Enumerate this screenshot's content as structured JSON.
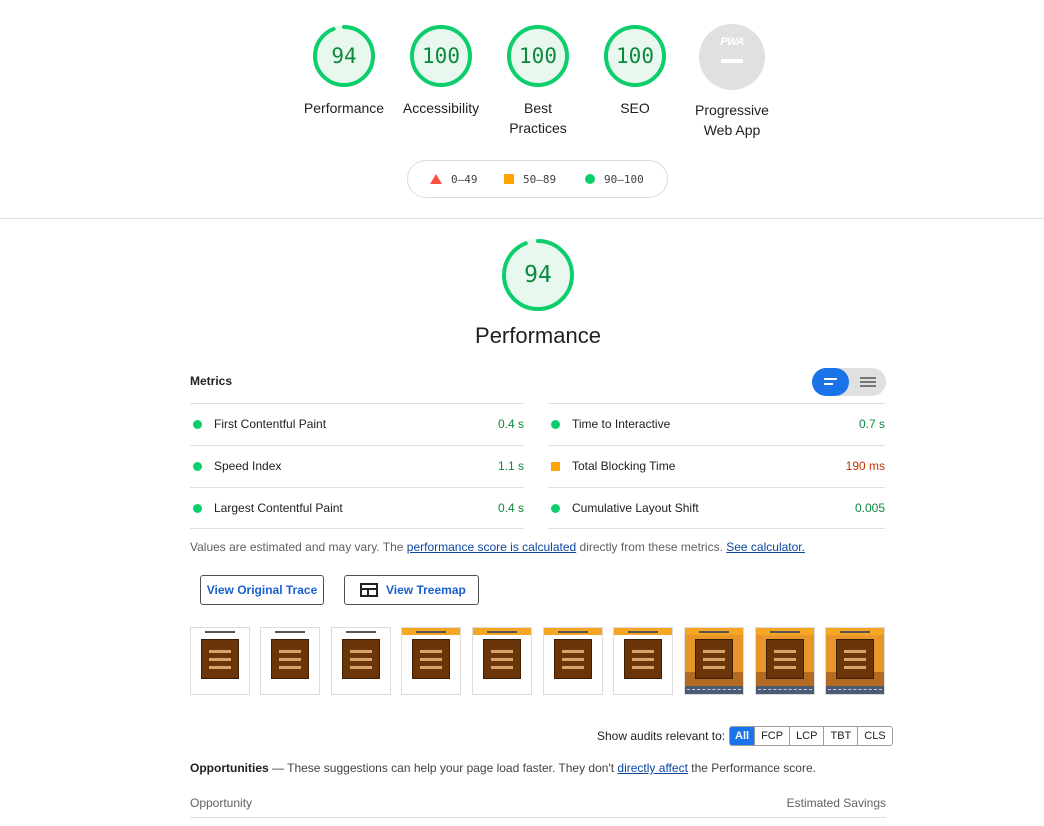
{
  "categories": [
    {
      "score": "94",
      "label": "Performance",
      "fraction": 0.94
    },
    {
      "score": "100",
      "label": "Accessibility",
      "fraction": 1.0
    },
    {
      "score": "100",
      "label": "Best Practices",
      "fraction": 1.0
    },
    {
      "score": "100",
      "label": "SEO",
      "fraction": 1.0
    }
  ],
  "pwa": {
    "badge_text": "PWA",
    "label": "Progressive Web App"
  },
  "legend": {
    "fail": "0–49",
    "average": "50–89",
    "pass": "90–100"
  },
  "performance": {
    "score": "94",
    "fraction": 0.94,
    "title": "Performance",
    "metrics_heading": "Metrics",
    "metrics_left": [
      {
        "name": "First Contentful Paint",
        "value": "0.4 s",
        "rating": "pass"
      },
      {
        "name": "Speed Index",
        "value": "1.1 s",
        "rating": "pass"
      },
      {
        "name": "Largest Contentful Paint",
        "value": "0.4 s",
        "rating": "pass"
      }
    ],
    "metrics_right": [
      {
        "name": "Time to Interactive",
        "value": "0.7 s",
        "rating": "pass"
      },
      {
        "name": "Total Blocking Time",
        "value": "190 ms",
        "rating": "average"
      },
      {
        "name": "Cumulative Layout Shift",
        "value": "0.005",
        "rating": "pass"
      }
    ],
    "note_prefix": "Values are estimated and may vary. The ",
    "note_link": "performance score is calculated",
    "note_middle": " directly from these metrics. ",
    "note_link2": "See calculator.",
    "view_trace": "View Original Trace",
    "view_treemap": "View Treemap"
  },
  "filmstrip": [
    {
      "header": "#ffffff",
      "bg": "#ffffff"
    },
    {
      "header": "#ffffff",
      "bg": "#ffffff"
    },
    {
      "header": "#ffffff",
      "bg": "#ffffff"
    },
    {
      "header": "#f5a623",
      "bg": "#ffffff"
    },
    {
      "header": "#f5a623",
      "bg": "#ffffff"
    },
    {
      "header": "#f5a623",
      "bg": "#ffffff"
    },
    {
      "header": "#f5a623",
      "bg": "#ffffff"
    },
    {
      "header": "#f5a623",
      "bg": "#e8952a",
      "scene": true
    },
    {
      "header": "#f5a623",
      "bg": "#e8952a",
      "scene": true
    },
    {
      "header": "#f5a623",
      "bg": "#e8952a",
      "scene": true
    }
  ],
  "audit_filter": {
    "label": "Show audits relevant to:",
    "chips": [
      "All",
      "FCP",
      "LCP",
      "TBT",
      "CLS"
    ],
    "active": "All"
  },
  "opportunities": {
    "title": "Opportunities",
    "desc_prefix": " — These suggestions can help your page load faster. They don't ",
    "desc_link": "directly affect",
    "desc_suffix": " the Performance score.",
    "col_left": "Opportunity",
    "col_right": "Estimated Savings"
  },
  "colors": {
    "pass": "#0cce6b",
    "pass_text": "#0c8a3e",
    "average": "#ffa400",
    "average_text": "#c33300",
    "fail": "#ff4e42",
    "link": "#0d47a1",
    "accent": "#1a73e8"
  }
}
